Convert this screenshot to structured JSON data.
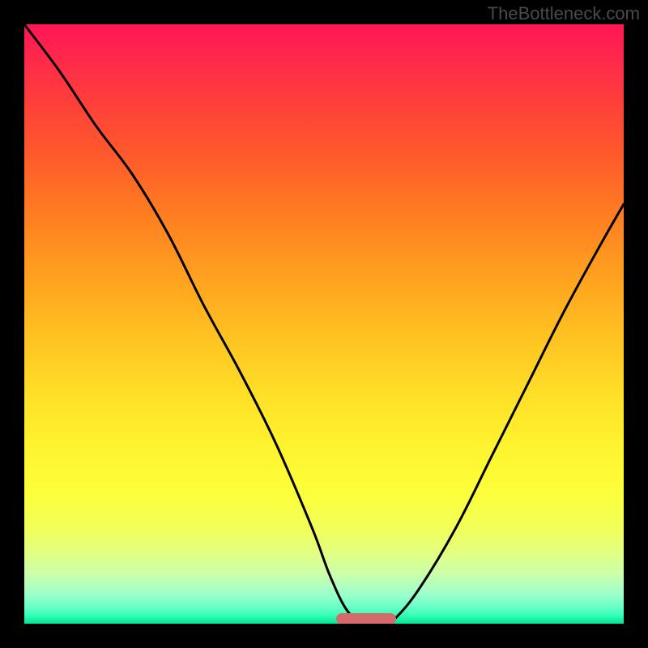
{
  "attribution": "TheBottleneck.com",
  "chart_data": {
    "type": "line",
    "title": "",
    "xlabel": "",
    "ylabel": "",
    "xlim": [
      0,
      100
    ],
    "ylim": [
      0,
      100
    ],
    "series": [
      {
        "name": "bottleneck-curve",
        "x": [
          0,
          6,
          12,
          18,
          24,
          30,
          36,
          42,
          48,
          51,
          54,
          57,
          60,
          62,
          66,
          72,
          78,
          84,
          90,
          96,
          100
        ],
        "values": [
          100,
          92,
          83,
          75,
          65,
          53,
          42,
          30,
          16,
          8,
          2,
          0,
          0,
          1,
          6,
          16,
          28,
          40,
          52,
          63,
          70
        ]
      }
    ],
    "marker": {
      "x_start": 52,
      "x_end": 62,
      "y": 0
    },
    "background_gradient_meaning": "red=high bottleneck, green=low bottleneck"
  }
}
